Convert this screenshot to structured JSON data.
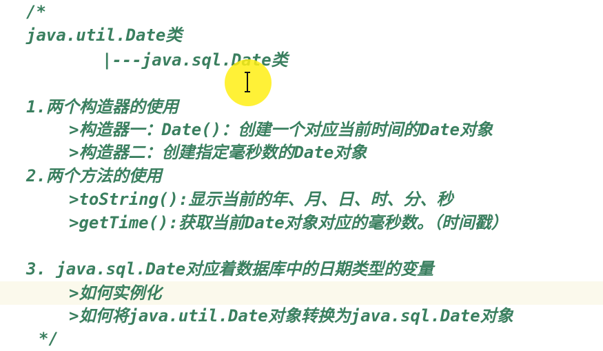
{
  "editor": {
    "lines": [
      "/*",
      "java.util.Date类",
      "|---java.sql.Date类",
      "1.两个构造器的使用",
      ">构造器一：Date()：创建一个对应当前时间的Date对象",
      ">构造器二：创建指定毫秒数的Date对象",
      "2.两个方法的使用",
      ">toString():显示当前的年、月、日、时、分、秒",
      ">getTime():获取当前Date对象对应的毫秒数。（时间戳）",
      "3. java.sql.Date对应着数据库中的日期类型的变量",
      ">如何实例化",
      ">如何将java.util.Date对象转换为java.sql.Date对象",
      "*/"
    ],
    "cursor_icon": "text-cursor-icon"
  }
}
